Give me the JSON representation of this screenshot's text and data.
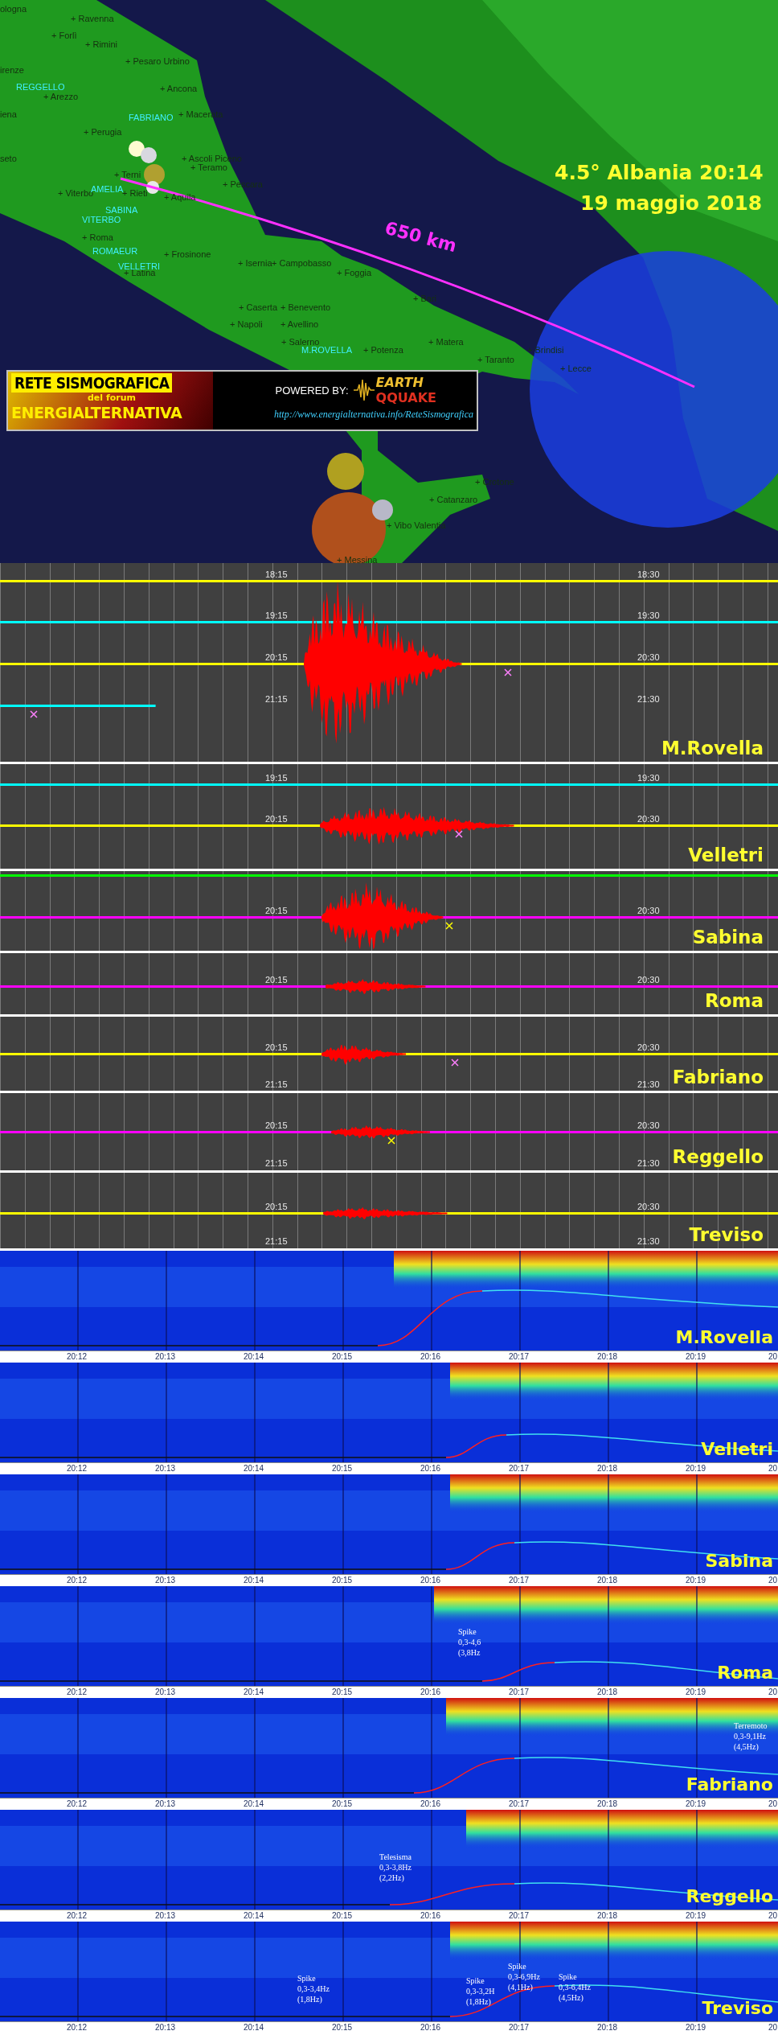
{
  "map": {
    "title": "4.5° Albania 20:14",
    "date": "19 maggio 2018",
    "distance": "650 km",
    "stations": [
      "REGGELLO",
      "FABRIANO",
      "AMELIA",
      "SABINA",
      "VITERBO",
      "ROMAEUR",
      "VELLETRI",
      "M.ROVELLA"
    ],
    "cities": [
      "ologna",
      "+ Ravenna",
      "+ Forlì",
      "+ Rimini",
      "irenze",
      "+ Pesaro Urbino",
      "+ Ancona",
      "+ Arezzo",
      "iena",
      "+ Macerata",
      "+ Perugia",
      "seto",
      "+ Ascoli Piceno",
      "+ Teramo",
      "+ Terni",
      "+ Viterbo",
      "+ Rieti",
      "+ Aquila",
      "+ Pescara",
      "+ Roma",
      "+ Frosinone",
      "+ Isernia",
      "+ Campobasso",
      "+ Foggia",
      "+ Latina",
      "+ Caserta",
      "+ Benevento",
      "+ Bari",
      "+ Napoli",
      "+ Avellino",
      "+ Salerno",
      "+ Potenza",
      "+ Matera",
      "+ Taranto",
      "+ Brindisi",
      "+ Lecce",
      "+ Crotone",
      "+ Catanzaro",
      "+ Vibo Valentia",
      "+ Messina"
    ],
    "logo": {
      "title": "RETE SISMOGRAFICA",
      "subtitle": "del forum",
      "name": "ENERGIALTERNATIVA",
      "powered": "POWERED BY:",
      "brand_top": "EARTH",
      "brand_bottom": "QQUAKE",
      "url": "http://www.energialternativa.info/ReteSismografica"
    }
  },
  "seismograph": {
    "stations": [
      {
        "name": "M.Rovella",
        "traces": [
          {
            "left_time": "18:15",
            "right_time": "18:30",
            "color": "#ffff00",
            "level": 1
          },
          {
            "left_time": "19:15",
            "right_time": "19:30",
            "color": "#00ffff",
            "level": 1
          },
          {
            "left_time": "20:15",
            "right_time": "20:30",
            "color": "#ffff00",
            "level": 1
          },
          {
            "left_time": "21:15",
            "right_time": "21:30",
            "color": "#00ffff",
            "level": 0.2
          }
        ]
      },
      {
        "name": "Velletri",
        "traces": [
          {
            "left_time": "19:15",
            "right_time": "19:30",
            "color": "#00ffff",
            "level": 1
          },
          {
            "left_time": "20:15",
            "right_time": "20:30",
            "color": "#ffff00",
            "level": 1
          }
        ]
      },
      {
        "name": "Sabina",
        "traces": [
          {
            "color": "#00ff00",
            "level": 1
          },
          {
            "left_time": "20:15",
            "right_time": "20:30",
            "color": "#ff00ff",
            "level": 1
          }
        ]
      },
      {
        "name": "Roma",
        "traces": [
          {
            "left_time": "20:15",
            "right_time": "20:30",
            "color": "#ff00ff",
            "level": 1
          }
        ]
      },
      {
        "name": "Fabriano",
        "traces": [
          {
            "left_time": "20:15",
            "right_time": "20:30",
            "color": "#ffff00",
            "level": 1
          },
          {
            "left_time": "21:15",
            "right_time": "21:30"
          }
        ]
      },
      {
        "name": "Reggello",
        "traces": [
          {
            "left_time": "20:15",
            "right_time": "20:30",
            "color": "#ff00ff",
            "level": 1
          },
          {
            "left_time": "21:15",
            "right_time": "21:30"
          }
        ]
      },
      {
        "name": "Treviso",
        "traces": [
          {
            "left_time": "20:15",
            "right_time": "20:30",
            "color": "#ffff00",
            "level": 1
          },
          {
            "left_time": "21:15",
            "right_time": "21:30"
          }
        ]
      }
    ]
  },
  "spectrograms": [
    {
      "name": "M.Rovella",
      "ticks": [
        "20:12",
        "20:13",
        "20:14",
        "20:15",
        "20:16",
        "20:17",
        "20:18",
        "20:19",
        "20"
      ]
    },
    {
      "name": "Velletri",
      "ticks": [
        "20:12",
        "20:13",
        "20:14",
        "20:15",
        "20:16",
        "20:17",
        "20:18",
        "20:19",
        "20"
      ]
    },
    {
      "name": "Sabina",
      "ticks": [
        "20:12",
        "20:13",
        "20:14",
        "20:15",
        "20:16",
        "20:17",
        "20:18",
        "20:19",
        "20"
      ]
    },
    {
      "name": "Roma",
      "ticks": [
        "20:12",
        "20:13",
        "20:14",
        "20:15",
        "20:16",
        "20:17",
        "20:18",
        "20:19",
        "20"
      ],
      "annotations": [
        {
          "lines": [
            "Spike",
            "0,3-4,6",
            "(3,8Hz"
          ]
        }
      ]
    },
    {
      "name": "Fabriano",
      "ticks": [
        "20:12",
        "20:13",
        "20:14",
        "20:15",
        "20:16",
        "20:17",
        "20:18",
        "20:19",
        "20"
      ],
      "annotations": [
        {
          "lines": [
            "Terremoto",
            "0,3-9,1Hz",
            "(4,5Hz)"
          ]
        }
      ]
    },
    {
      "name": "Reggello",
      "ticks": [
        "20:12",
        "20:13",
        "20:14",
        "20:15",
        "20:16",
        "20:17",
        "20:18",
        "20:19",
        "20"
      ],
      "annotations": [
        {
          "lines": [
            "Telesisma",
            "0,3-3,8Hz",
            "(2,2Hz)"
          ]
        }
      ]
    },
    {
      "name": "Treviso",
      "ticks": [
        "20:12",
        "20:13",
        "20:14",
        "20:15",
        "20:16",
        "20:17",
        "20:18",
        "20:19",
        "20"
      ],
      "annotations": [
        {
          "lines": [
            "Spike",
            "0,3-3,4Hz",
            "(1,8Hz)"
          ]
        },
        {
          "lines": [
            "Spike",
            "0,3-3,2H",
            "(1,8Hz)"
          ]
        },
        {
          "lines": [
            "Spike",
            "0,3-6,9Hz",
            "(4,1Hz)"
          ]
        },
        {
          "lines": [
            "Spike",
            "0,3-6,4Hz",
            "(4,5Hz)"
          ]
        }
      ]
    }
  ]
}
